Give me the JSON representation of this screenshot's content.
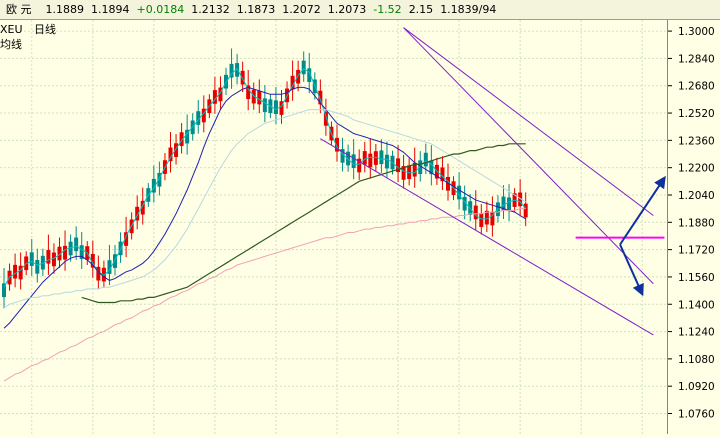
{
  "quote_bar": {
    "pair": "欧 元",
    "fields": [
      {
        "text": "1.1889",
        "color": "#000000"
      },
      {
        "text": "1.1894",
        "color": "#000000"
      },
      {
        "text": "+0.0184",
        "color": "#008000"
      },
      {
        "text": "1.2132",
        "color": "#000000"
      },
      {
        "text": "1.1873",
        "color": "#000000"
      },
      {
        "text": "1.2072",
        "color": "#000000"
      },
      {
        "text": "1.2073",
        "color": "#000000"
      },
      {
        "text": "-1.52",
        "color": "#008000"
      },
      {
        "text": "2.15",
        "color": "#000000"
      },
      {
        "text": "1.1839/94",
        "color": "#000000"
      }
    ]
  },
  "legend": {
    "symbol": "XEU",
    "period": "日线",
    "indicator": "均线"
  },
  "colors": {
    "background": "#ffffe6",
    "grid": "#cfe0c0",
    "candle_up": "#e60000",
    "candle_down": "#008c8c",
    "ma_short": "#00c0c0",
    "ma_mid": "#2020b0",
    "ma_long": "#b8d8e0",
    "ma_xlong": "#305820",
    "ma_yearly": "#f4a0b0",
    "trendline": "#8020c8",
    "support": "#ff00ff",
    "arrow": "#1030a0"
  },
  "chart_data": {
    "type": "candlestick",
    "y_axis_side": "right",
    "ylim": [
      1.064,
      1.3065
    ],
    "yticks": [
      "1.3000",
      "1.2840",
      "1.2680",
      "1.2520",
      "1.2360",
      "1.2200",
      "1.2040",
      "1.1880",
      "1.1720",
      "1.1560",
      "1.1400",
      "1.1240",
      "1.1080",
      "1.0920",
      "1.0760"
    ],
    "x_count": 100,
    "grid": true,
    "moving_averages": [
      {
        "key": "ma_short",
        "values": [
          1.15,
          1.156,
          1.158,
          1.16,
          1.164,
          1.165,
          1.163,
          1.164,
          1.166,
          1.167,
          1.169,
          1.172,
          1.173,
          1.174,
          1.172,
          1.17,
          1.164,
          1.159,
          1.157,
          1.16,
          1.166,
          1.172,
          1.18,
          1.186,
          1.192,
          1.198,
          1.204,
          1.208,
          1.214,
          1.22,
          1.226,
          1.231,
          1.236,
          1.24,
          1.244,
          1.248,
          1.252,
          1.256,
          1.26,
          1.264,
          1.27,
          1.275,
          1.278,
          1.272,
          1.266,
          1.262,
          1.26,
          1.258,
          1.256,
          1.254,
          1.256,
          1.262,
          1.268,
          1.274,
          1.278,
          1.276,
          1.268,
          1.26,
          1.25,
          1.24,
          1.232,
          1.228,
          1.225,
          1.222,
          1.222,
          1.225,
          1.226,
          1.226,
          1.225,
          1.225,
          1.223,
          1.22,
          1.218,
          1.217,
          1.217,
          1.221,
          1.224,
          1.222,
          1.218,
          1.215,
          1.212,
          1.208,
          1.204,
          1.2,
          1.196,
          1.192,
          1.19,
          1.19,
          1.192,
          1.196,
          1.198,
          1.2,
          1.201,
          1.2,
          1.196
        ]
      },
      {
        "key": "ma_mid",
        "values": [
          1.126,
          1.129,
          1.133,
          1.137,
          1.141,
          1.145,
          1.149,
          1.153,
          1.156,
          1.159,
          1.162,
          1.165,
          1.167,
          1.168,
          1.168,
          1.166,
          1.163,
          1.159,
          1.156,
          1.154,
          1.155,
          1.157,
          1.159,
          1.16,
          1.162,
          1.164,
          1.167,
          1.171,
          1.176,
          1.181,
          1.187,
          1.193,
          1.2,
          1.207,
          1.215,
          1.223,
          1.232,
          1.24,
          1.247,
          1.254,
          1.259,
          1.262,
          1.264,
          1.266,
          1.267,
          1.266,
          1.265,
          1.264,
          1.263,
          1.263,
          1.263,
          1.264,
          1.266,
          1.267,
          1.267,
          1.266,
          1.262,
          1.258,
          1.254,
          1.25,
          1.246,
          1.244,
          1.242,
          1.24,
          1.239,
          1.238,
          1.237,
          1.236,
          1.235,
          1.234,
          1.233,
          1.231,
          1.229,
          1.226,
          1.223,
          1.221,
          1.219,
          1.217,
          1.215,
          1.213,
          1.211,
          1.209,
          1.207,
          1.205,
          1.203,
          1.201,
          1.2,
          1.199,
          1.198,
          1.197,
          1.196,
          1.195,
          1.194,
          1.192,
          1.19
        ]
      },
      {
        "key": "ma_long",
        "values": [
          1.138,
          1.14,
          1.141,
          1.142,
          1.143,
          1.144,
          1.144,
          1.145,
          1.145,
          1.146,
          1.146,
          1.147,
          1.147,
          1.148,
          1.148,
          1.149,
          1.149,
          1.149,
          1.15,
          1.15,
          1.151,
          1.152,
          1.153,
          1.154,
          1.155,
          1.156,
          1.158,
          1.16,
          1.163,
          1.166,
          1.17,
          1.174,
          1.179,
          1.184,
          1.19,
          1.196,
          1.202,
          1.208,
          1.214,
          1.22,
          1.225,
          1.23,
          1.234,
          1.237,
          1.24,
          1.242,
          1.244,
          1.246,
          1.247,
          1.248,
          1.249,
          1.25,
          1.251,
          1.252,
          1.253,
          1.254,
          1.254,
          1.254,
          1.254,
          1.253,
          1.252,
          1.251,
          1.25,
          1.248,
          1.247,
          1.246,
          1.245,
          1.244,
          1.243,
          1.242,
          1.241,
          1.24,
          1.239,
          1.238,
          1.237,
          1.236,
          1.235,
          1.234,
          1.232,
          1.23,
          1.228,
          1.226,
          1.224,
          1.222,
          1.22,
          1.218,
          1.216,
          1.214,
          1.212,
          1.21,
          1.208,
          1.206,
          1.204,
          1.202,
          1.2
        ]
      },
      {
        "key": "ma_xlong",
        "values": [
          null,
          null,
          null,
          null,
          null,
          null,
          null,
          null,
          null,
          null,
          null,
          null,
          null,
          null,
          1.144,
          1.143,
          1.142,
          1.141,
          1.141,
          1.141,
          1.141,
          1.142,
          1.142,
          1.142,
          1.143,
          1.143,
          1.144,
          1.144,
          1.145,
          1.146,
          1.147,
          1.148,
          1.149,
          1.15,
          1.152,
          1.154,
          1.156,
          1.158,
          1.16,
          1.162,
          1.164,
          1.166,
          1.168,
          1.17,
          1.172,
          1.174,
          1.176,
          1.178,
          1.18,
          1.182,
          1.184,
          1.186,
          1.188,
          1.19,
          1.192,
          1.194,
          1.196,
          1.198,
          1.2,
          1.202,
          1.204,
          1.206,
          1.208,
          1.21,
          1.212,
          1.213,
          1.214,
          1.215,
          1.216,
          1.217,
          1.218,
          1.219,
          1.22,
          1.221,
          1.222,
          1.222,
          1.223,
          1.224,
          1.225,
          1.226,
          1.227,
          1.228,
          1.228,
          1.229,
          1.23,
          1.23,
          1.231,
          1.232,
          1.232,
          1.233,
          1.233,
          1.234,
          1.234,
          1.234,
          1.234
        ]
      },
      {
        "key": "ma_yearly",
        "values": [
          1.095,
          1.097,
          1.099,
          1.1,
          1.102,
          1.104,
          1.105,
          1.107,
          1.108,
          1.11,
          1.112,
          1.113,
          1.115,
          1.116,
          1.118,
          1.12,
          1.121,
          1.123,
          1.124,
          1.126,
          1.128,
          1.129,
          1.131,
          1.132,
          1.134,
          1.136,
          1.137,
          1.139,
          1.14,
          1.142,
          1.144,
          1.145,
          1.147,
          1.148,
          1.15,
          1.152,
          1.153,
          1.155,
          1.156,
          1.158,
          1.16,
          1.161,
          1.163,
          1.164,
          1.165,
          1.166,
          1.167,
          1.168,
          1.169,
          1.17,
          1.171,
          1.172,
          1.173,
          1.174,
          1.175,
          1.176,
          1.177,
          1.178,
          1.179,
          1.179,
          1.18,
          1.181,
          1.182,
          1.182,
          1.183,
          1.184,
          1.184,
          1.185,
          1.185,
          1.186,
          1.186,
          1.187,
          1.187,
          1.188,
          1.188,
          1.189,
          1.189,
          1.19,
          1.19,
          1.191,
          1.191,
          1.191,
          1.192,
          1.192,
          1.193,
          1.193,
          1.193,
          1.194,
          1.194,
          1.194,
          1.195,
          1.195,
          1.195,
          1.196,
          1.196
        ]
      }
    ],
    "lines": [
      {
        "key": "trendline",
        "from": [
          57,
          1.237
        ],
        "to": [
          117,
          1.122
        ]
      },
      {
        "key": "trendline",
        "from": [
          72,
          1.302
        ],
        "to": [
          117,
          1.192
        ]
      },
      {
        "key": "trendline",
        "from": [
          72,
          1.302
        ],
        "to": [
          117,
          1.152
        ]
      },
      {
        "key": "support",
        "from": [
          103,
          1.179
        ],
        "to": [
          119,
          1.179
        ]
      }
    ],
    "arrows": [
      {
        "from": [
          111,
          1.175
        ],
        "to": [
          119,
          1.214
        ]
      },
      {
        "from": [
          111,
          1.175
        ],
        "to": [
          115,
          1.146
        ]
      }
    ]
  }
}
